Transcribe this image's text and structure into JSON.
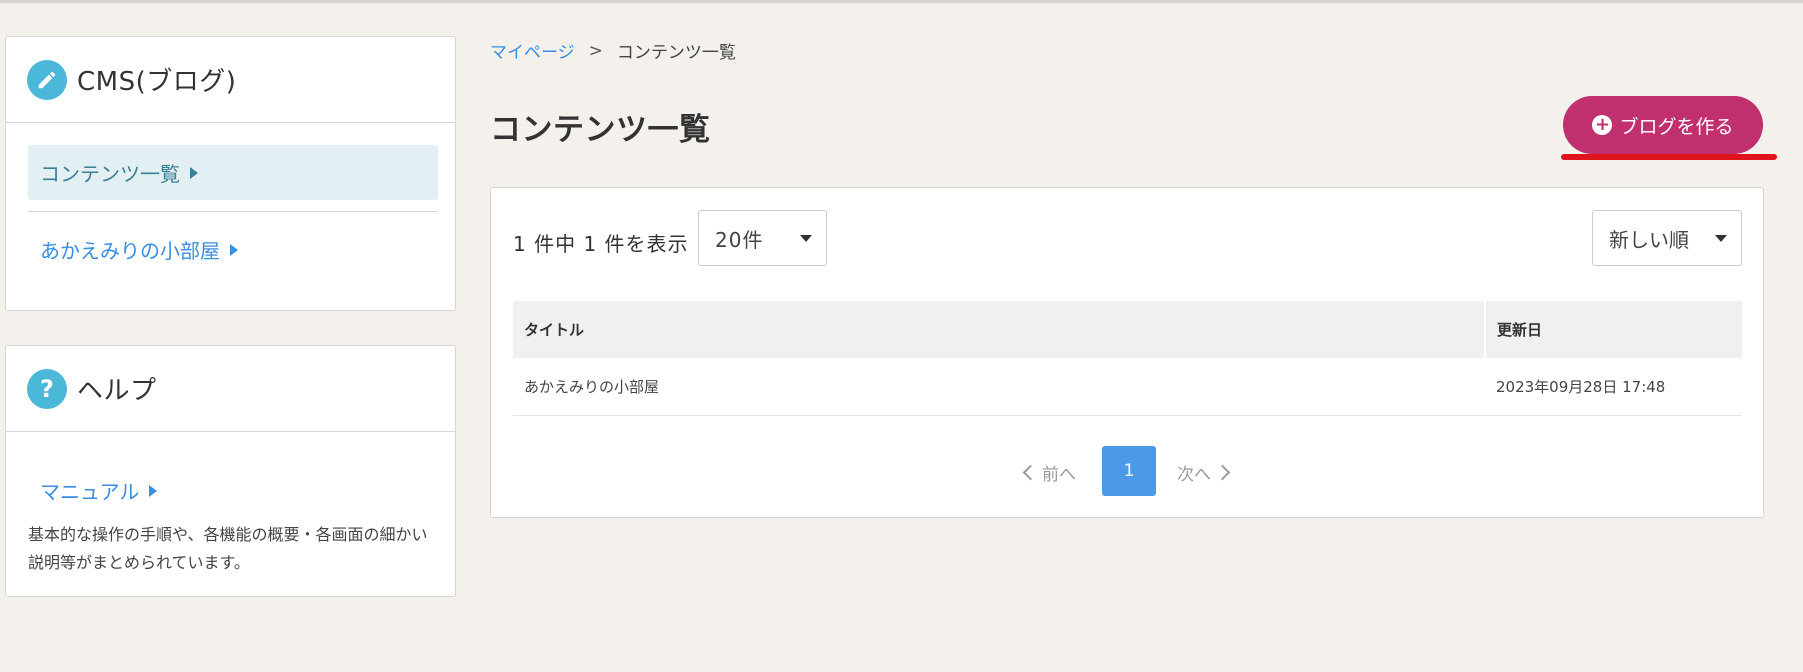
{
  "sidebar": {
    "cms": {
      "title": "CMS(ブログ)",
      "items": [
        {
          "label": "コンテンツ一覧",
          "active": true
        },
        {
          "label": "あかえみりの小部屋",
          "active": false
        }
      ]
    },
    "help": {
      "icon_char": "?",
      "title": "ヘルプ",
      "link": "マニュアル",
      "description": "基本的な操作の手順や、各機能の概要・各画面の細かい説明等がまとめられています。"
    }
  },
  "breadcrumb": {
    "home": "マイページ",
    "separator": ">",
    "current": "コンテンツ一覧"
  },
  "page_title": "コンテンツ一覧",
  "create_button": {
    "label": "ブログを作る",
    "icon_char": "+",
    "color": "#c0306e"
  },
  "list": {
    "count_text": "1 件中 1 件を表示",
    "per_page": "20件",
    "sort": "新しい順",
    "columns": {
      "title": "タイトル",
      "updated": "更新日"
    },
    "rows": [
      {
        "title": "あかえみりの小部屋",
        "updated": "2023年09月28日 17:48"
      }
    ]
  },
  "pagination": {
    "prev": "前へ",
    "current": "1",
    "next": "次へ"
  },
  "colors": {
    "accent": "#4bb8d9",
    "link": "#3a8ee0",
    "pager_active": "#4a9ae8",
    "highlight": "#e0141c"
  }
}
